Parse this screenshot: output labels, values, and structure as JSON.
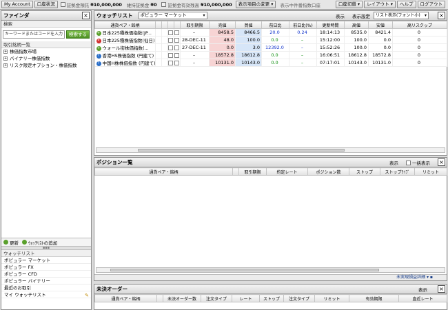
{
  "topbar": {
    "account_btn": "My Account",
    "status_btn": "口座状況",
    "info": [
      {
        "label": "証拠金預託",
        "value": "¥10,000,000"
      },
      {
        "label": "維持証拠金",
        "value": "¥0"
      },
      {
        "label": "証拠金有効残高",
        "value": "¥10,000,000"
      }
    ],
    "display_change": "表示項目の変更",
    "display_currency_label": "表示中件番指数口座",
    "switch_account": "口座切替",
    "layout": "レイアウト",
    "help": "ヘルプ",
    "logout": "ログアウト"
  },
  "finder": {
    "title": "ファインダ",
    "search_section": "検索",
    "search_placeholder": "キーワードまたはコードを入力",
    "search_button": "検索する",
    "list_section": "取引銘柄一覧",
    "tree": [
      "株価指数市場",
      "バイナリー株価指数",
      "リスク限定オプション・株価指数"
    ],
    "refresh": "更新",
    "add_watch": "ｳｫｯﾁﾘｽﾄの追加",
    "watch_section": "ウォッチリスト",
    "watchlists": [
      "ポピュラー マーケット",
      "ポピュラー FX",
      "ポピュラー CFD",
      "ポピュラー バイナリー",
      "最近のお取引",
      "マイ ウォッチリスト"
    ]
  },
  "watch": {
    "title": "ウォッチリスト",
    "list_select": "ポピュラー マーケット",
    "display": "表示",
    "display_settings": "表示設定",
    "view_select": "リスト表示(フォント小)",
    "columns": [
      "通貨ペア・銘柄",
      "",
      "",
      "",
      "",
      "取引期限",
      "売値",
      "買値",
      "前日比",
      "前日比(%)",
      "更新時間",
      "高値",
      "安値",
      "高リスクップ"
    ],
    "rows": [
      {
        "icon_color": "#5aa02c",
        "icon": "+",
        "name": "日本225種株価指数(JP...",
        "expiry": "–",
        "sell": "8458.5",
        "buy": "8466.5",
        "chg": "20.0",
        "chgp": "0.24",
        "time": "18:14:13",
        "high": "8535.0",
        "low": "8421.4",
        "hr": "0",
        "chg_class": "pos"
      },
      {
        "icon_color": "#d02a2a",
        "icon": "×",
        "name": "日本225種株価指数(仙日)",
        "expiry": "28-DEC-11",
        "sell": "48.0",
        "buy": "100.0",
        "chg": "0.0",
        "chgp": "–",
        "time": "15:12:00",
        "high": "100.0",
        "low": "0.0",
        "hr": "0",
        "chg_class": "neg"
      },
      {
        "icon_color": "#5aa02c",
        "icon": "+",
        "name": "ウォール街株価指数(...",
        "expiry": "27-DEC-11",
        "sell": "0.0",
        "buy": "3.0",
        "chg": "12392.0",
        "chgp": "–",
        "time": "15:52:26",
        "high": "100.0",
        "low": "0.0",
        "hr": "0",
        "chg_class": "pos"
      },
      {
        "icon_color": "#2a6fc9",
        "icon": "?",
        "name": "香港HS株価指数 (円建て)",
        "expiry": "–",
        "sell": "18572.8",
        "buy": "18612.8",
        "chg": "0.0",
        "chgp": "–",
        "time": "16:06:51",
        "high": "18612.8",
        "low": "18572.8",
        "hr": "0",
        "chg_class": "neg"
      },
      {
        "icon_color": "#2a6fc9",
        "icon": "?",
        "name": "中国H株株価指数 (円建て)",
        "expiry": "–",
        "sell": "10131.0",
        "buy": "10143.0",
        "chg": "0.0",
        "chgp": "–",
        "time": "07:17:01",
        "high": "10143.0",
        "low": "10131.0",
        "hr": "0",
        "chg_class": "neg"
      }
    ]
  },
  "positions": {
    "title": "ポジション一覧",
    "display": "表示",
    "all_display": "一括表示",
    "columns": [
      "通貨ペア・銘柄",
      "",
      "取引期限",
      "約定レート",
      "ポジション数",
      "ストップ",
      "ストップﾗｲﾌﾞ",
      "リミット"
    ],
    "footer": "未実現損益詳細"
  },
  "orders": {
    "title": "未決オーダー",
    "display": "表示",
    "columns": [
      "通貨ペア・銘柄",
      "",
      "未決オーダー数",
      "注文タイプ",
      "レート",
      "ストップ",
      "注文タイプ",
      "リミット",
      "有効期限",
      "直近レート"
    ]
  }
}
